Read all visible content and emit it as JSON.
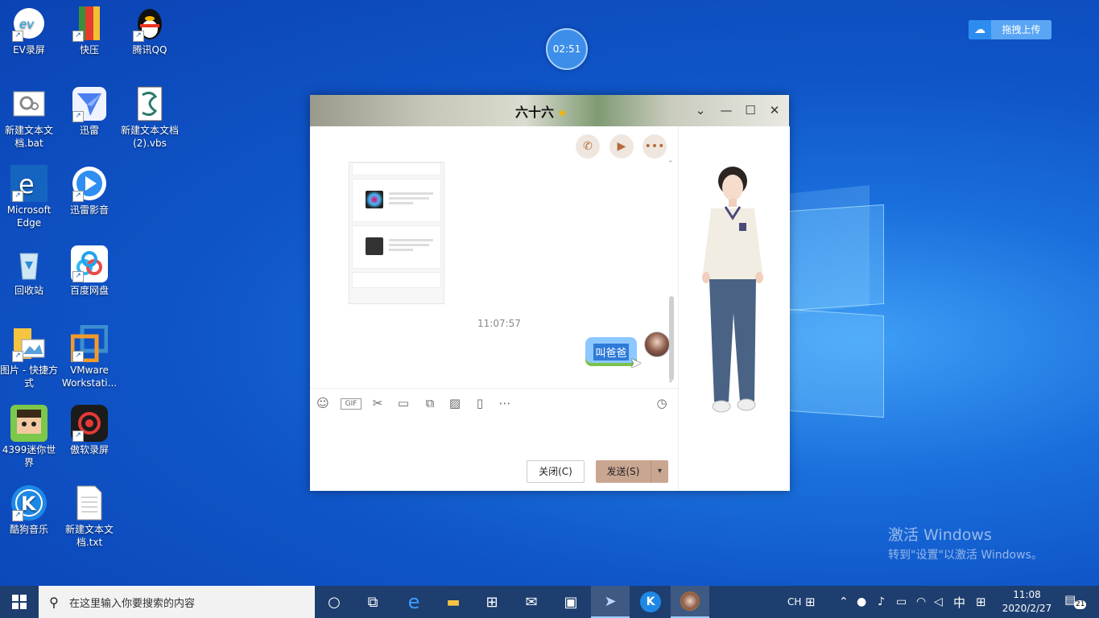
{
  "desktop": {
    "icons": [
      {
        "label": "EV录屏"
      },
      {
        "label": "快压"
      },
      {
        "label": "腾讯QQ"
      },
      {
        "label": "新建文本文档.bat"
      },
      {
        "label": "迅雷"
      },
      {
        "label": "新建文本文档 (2).vbs"
      },
      {
        "label": "Microsoft Edge"
      },
      {
        "label": "迅雷影音"
      },
      {
        "label": "回收站"
      },
      {
        "label": "百度网盘"
      },
      {
        "label": "图片 - 快捷方式"
      },
      {
        "label": "VMware Workstati..."
      },
      {
        "label": "4399迷你世界"
      },
      {
        "label": "傲软录屏"
      },
      {
        "label": "酷狗音乐"
      },
      {
        "label": "新建文本文档.txt"
      }
    ]
  },
  "recorder": {
    "timer": "02:51"
  },
  "upload_widget": {
    "label": "拖拽上传"
  },
  "activation": {
    "line1": "激活 Windows",
    "line2": "转到\"设置\"以激活 Windows。"
  },
  "chat": {
    "title": "六十六",
    "timestamp": "11:07:57",
    "message": "叫爸爸",
    "close_button": "关闭(C)",
    "send_button": "发送(S)",
    "colors": {
      "send_bg": "#c9a690",
      "bubble_bg": "#8cc8ff"
    }
  },
  "taskbar": {
    "search_placeholder": "在这里输入你要搜索的内容",
    "ime_lang": "CH",
    "ime_mode": "中",
    "time": "11:08",
    "date": "2020/2/27",
    "notification_count": "21"
  }
}
